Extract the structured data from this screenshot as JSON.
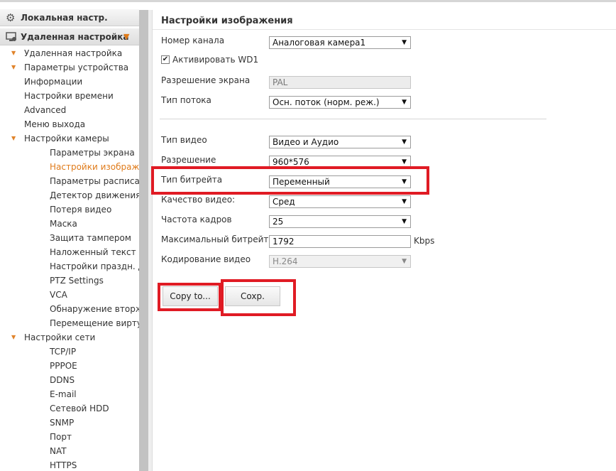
{
  "sidebar": {
    "local_header": "Локальная настр.",
    "remote_header": "Удаленная настройка",
    "items": [
      {
        "label": "Удаленная настройка",
        "level": 1,
        "arrow": true
      },
      {
        "label": "Параметры устройства",
        "level": 1,
        "arrow": true
      },
      {
        "label": "Информации",
        "level": 1,
        "arrow": false
      },
      {
        "label": "Настройки времени",
        "level": 1,
        "arrow": false
      },
      {
        "label": "Advanced",
        "level": 1,
        "arrow": false
      },
      {
        "label": "Меню выхода",
        "level": 1,
        "arrow": false
      },
      {
        "label": "Настройки камеры",
        "level": 1,
        "arrow": true
      },
      {
        "label": "Параметры экрана",
        "level": 2,
        "arrow": false
      },
      {
        "label": "Настройки изображени",
        "level": 2,
        "arrow": false,
        "active": true
      },
      {
        "label": "Параметры расписания",
        "level": 2,
        "arrow": false
      },
      {
        "label": "Детектор движения",
        "level": 2,
        "arrow": false
      },
      {
        "label": "Потеря видео",
        "level": 2,
        "arrow": false
      },
      {
        "label": "Маска",
        "level": 2,
        "arrow": false
      },
      {
        "label": "Защита тампером",
        "level": 2,
        "arrow": false
      },
      {
        "label": "Наложенный текст",
        "level": 2,
        "arrow": false
      },
      {
        "label": "Настройки праздн. Дня",
        "level": 2,
        "arrow": false
      },
      {
        "label": "PTZ Settings",
        "level": 2,
        "arrow": false
      },
      {
        "label": "VCA",
        "level": 2,
        "arrow": false
      },
      {
        "label": "Обнаружение вторжения",
        "level": 2,
        "arrow": false
      },
      {
        "label": "Перемещение виртуал",
        "level": 2,
        "arrow": false
      },
      {
        "label": "Настройки сети",
        "level": 1,
        "arrow": true
      },
      {
        "label": "TCP/IP",
        "level": 2,
        "arrow": false
      },
      {
        "label": "PPPOE",
        "level": 2,
        "arrow": false
      },
      {
        "label": "DDNS",
        "level": 2,
        "arrow": false
      },
      {
        "label": "E-mail",
        "level": 2,
        "arrow": false
      },
      {
        "label": "Сетевой HDD",
        "level": 2,
        "arrow": false
      },
      {
        "label": "SNMP",
        "level": 2,
        "arrow": false
      },
      {
        "label": "Порт",
        "level": 2,
        "arrow": false
      },
      {
        "label": "NAT",
        "level": 2,
        "arrow": false
      },
      {
        "label": "HTTPS",
        "level": 2,
        "arrow": false
      }
    ]
  },
  "main": {
    "title": "Настройки изображения",
    "channel_label": "Номер канала",
    "channel_value": "Аналоговая камера1",
    "wd1_label": "Активировать WD1",
    "resolution_screen_label": "Разрешение экрана",
    "resolution_screen_value": "PAL",
    "stream_type_label": "Тип потока",
    "stream_type_value": "Осн. поток (норм. реж.)",
    "video_type_label": "Тип видео",
    "video_type_value": "Видео и Аудио",
    "resolution_label": "Разрешение",
    "resolution_value": "960*576",
    "bitrate_type_label": "Тип битрейта",
    "bitrate_type_value": "Переменный",
    "video_quality_label": "Качество видео:",
    "video_quality_value": "Сред",
    "frame_rate_label": "Частота кадров",
    "frame_rate_value": "25",
    "max_bitrate_label": "Максимальный битрейт",
    "max_bitrate_value": "1792",
    "max_bitrate_unit": "Kbps",
    "encoding_label": "Кодирование видео",
    "encoding_value": "H.264",
    "copy_button": "Copy to...",
    "save_button": "Coxp."
  },
  "colors": {
    "accent": "#e07b1a",
    "highlight": "#e01b24"
  }
}
